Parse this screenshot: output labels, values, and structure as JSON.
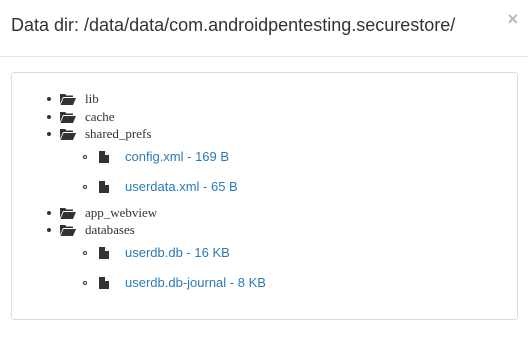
{
  "modal": {
    "title": "Data dir: /data/data/com.androidpentesting.securestore/",
    "close_glyph": "×"
  },
  "tree": {
    "dirs": [
      {
        "name": "lib"
      },
      {
        "name": "cache"
      },
      {
        "name": "shared_prefs",
        "files": [
          {
            "label": "config.xml - 169 B"
          },
          {
            "label": "userdata.xml - 65 B"
          }
        ]
      },
      {
        "name": "app_webview"
      },
      {
        "name": "databases",
        "files": [
          {
            "label": "userdb.db - 16 KB"
          },
          {
            "label": "userdb.db-journal - 8 KB"
          }
        ]
      }
    ]
  },
  "colors": {
    "link": "#2a7ab8",
    "text": "#333333",
    "border": "#dddddd"
  },
  "icons": {
    "folder": "folder-open-icon",
    "file": "file-icon"
  }
}
